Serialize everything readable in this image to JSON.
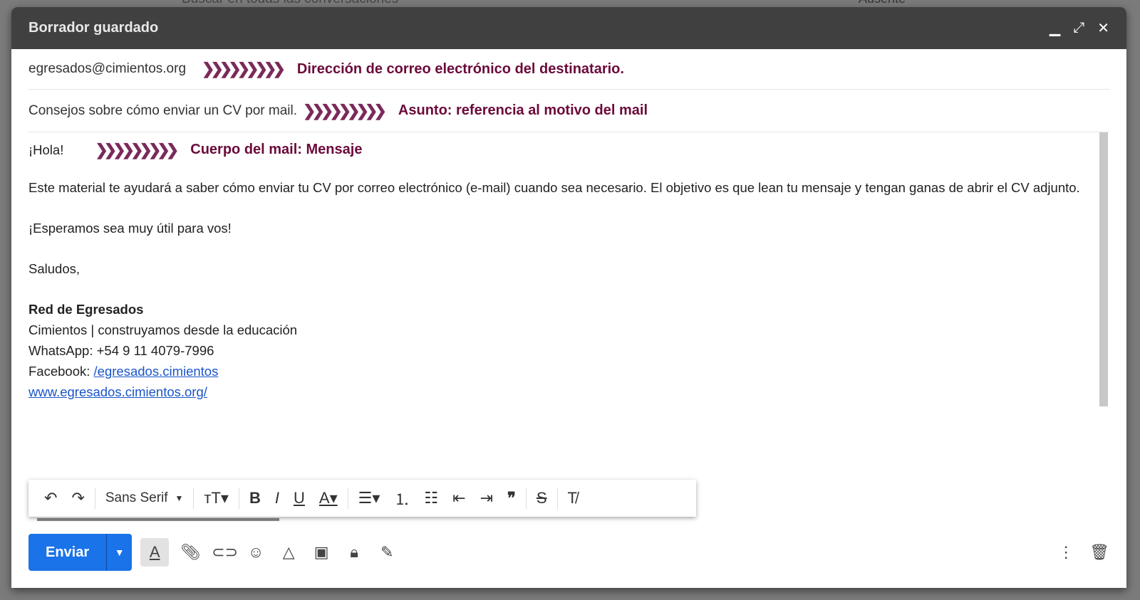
{
  "background": {
    "search_placeholder": "Buscar en todas las conversaciones",
    "status": "Ausente"
  },
  "window": {
    "title": "Borrador guardado",
    "controls": [
      "minimize-icon",
      "exit-fullscreen-icon",
      "close-icon"
    ]
  },
  "to": {
    "value": "egresados@cimientos.org",
    "note": "Dirección de correo electrónico del destinatario."
  },
  "subject": {
    "value": "Consejos sobre cómo enviar un CV por mail.",
    "note": "Asunto: referencia al motivo del mail"
  },
  "body": {
    "greeting": "¡Hola!",
    "note": "Cuerpo del mail:  Mensaje",
    "paragraph": "Este material te ayudará a saber cómo enviar tu CV por correo electrónico (e-mail) cuando sea necesario. El objetivo es que lean tu mensaje y tengan ganas de abrir el CV adjunto.",
    "closing_line": "¡Esperamos sea muy útil para vos!",
    "regards": "Saludos,",
    "signature": {
      "name": "Red de Egresados",
      "org": "Cimientos | construyamos desde la educación",
      "whatsapp": "WhatsApp: +54 9 11 4079-7996",
      "facebook_label": "Facebook: ",
      "facebook_link": "/egresados.cimientos",
      "website": "www.egresados.cimientos.org/"
    }
  },
  "formatting": {
    "font": "Sans Serif"
  },
  "footer": {
    "send": "Enviar"
  },
  "colors": {
    "accent": "#1a73e8",
    "annotation": "#6b0a3a",
    "header": "#404040"
  }
}
